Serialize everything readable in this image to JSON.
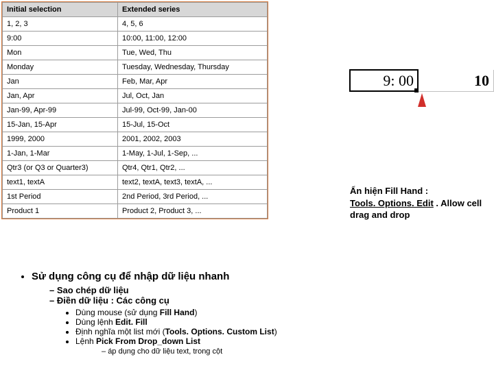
{
  "table": {
    "headers": [
      "Initial selection",
      "Extended series"
    ],
    "rows": [
      [
        "1, 2, 3",
        "4, 5, 6"
      ],
      [
        "9:00",
        "10:00, 11:00, 12:00"
      ],
      [
        "Mon",
        "Tue, Wed, Thu"
      ],
      [
        "Monday",
        "Tuesday, Wednesday, Thursday"
      ],
      [
        "Jan",
        "Feb, Mar, Apr"
      ],
      [
        "Jan, Apr",
        "Jul, Oct, Jan"
      ],
      [
        "Jan-99, Apr-99",
        "Jul-99, Oct-99, Jan-00"
      ],
      [
        "15-Jan, 15-Apr",
        "15-Jul, 15-Oct"
      ],
      [
        "1999, 2000",
        "2001, 2002, 2003"
      ],
      [
        "1-Jan, 1-Mar",
        "1-May, 1-Jul, 1-Sep, ..."
      ],
      [
        "Qtr3 (or Q3 or Quarter3)",
        "Qtr4, Qtr1, Qtr2, ..."
      ],
      [
        "text1, textA",
        "text2, textA, text3, textA, ..."
      ],
      [
        "1st Period",
        "2nd Period, 3rd Period, ..."
      ],
      [
        "Product 1",
        "Product 2, Product 3, ..."
      ]
    ]
  },
  "cells": {
    "a": "9: 00",
    "b": "10"
  },
  "note": {
    "line1": "Ẩn hiện Fill Hand :",
    "line2_a": "Tools. Options. Edit",
    "line2_b": " . Allow cell drag and drop"
  },
  "bullets": {
    "lv1": "Sử dụng công cụ để nhập dữ liệu nhanh",
    "lv2": [
      "Sao chép dữ liệu",
      "Điền dữ liệu : Các công cụ"
    ],
    "lv3": [
      {
        "pre": "Dùng mouse (sử dụng ",
        "bold": "Fill Hand",
        "post": ")"
      },
      {
        "pre": "Dùng lệnh ",
        "bold": "Edit. Fill",
        "post": ""
      },
      {
        "pre": "Định nghĩa một list mới (",
        "bold": "Tools. Options. Custom List",
        "post": ")"
      },
      {
        "pre": "Lệnh ",
        "bold": "Pick From Drop_down List",
        "post": ""
      }
    ],
    "lv4": "áp dụng cho dữ liệu text, trong cột"
  }
}
